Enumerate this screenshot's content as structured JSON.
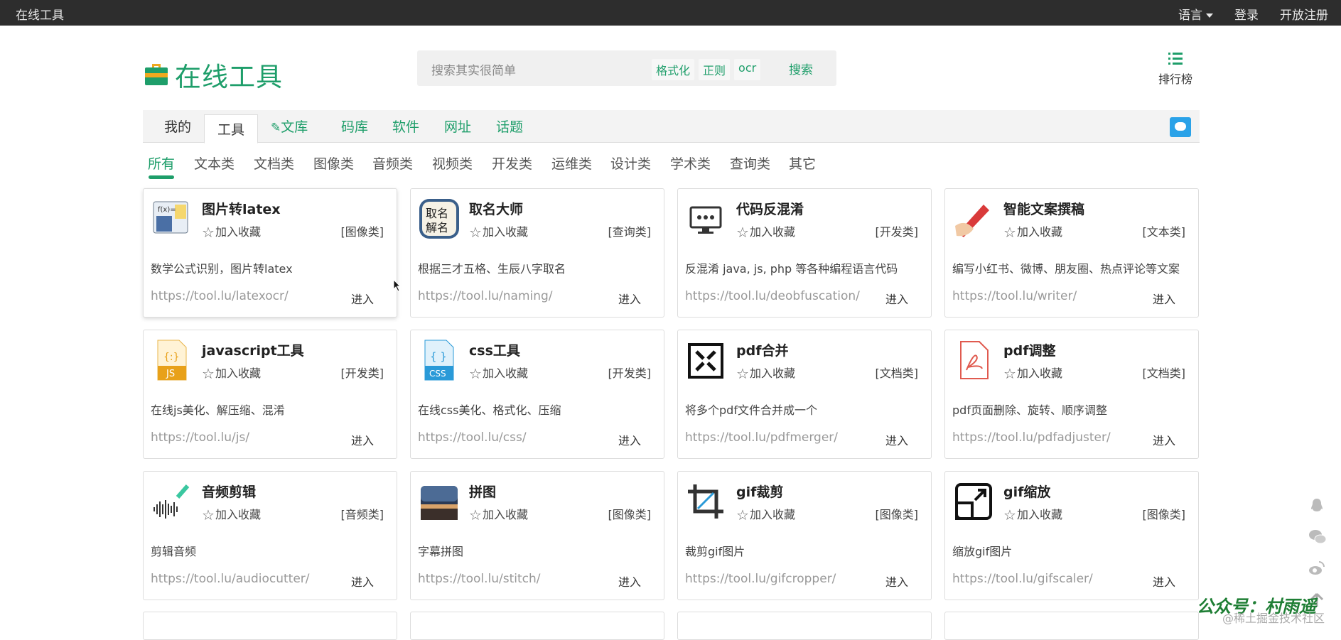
{
  "topbar": {
    "site": "在线工具",
    "language": "语言",
    "login": "登录",
    "register": "开放注册"
  },
  "logo": {
    "text": "在线工具"
  },
  "search": {
    "placeholder": "搜索其实很简单",
    "quick": [
      "格式化",
      "正则",
      "ocr"
    ],
    "button": "搜索"
  },
  "rank": {
    "label": "排行榜"
  },
  "nav": {
    "tabs": [
      "我的",
      "工具",
      "文库",
      "码库",
      "软件",
      "网址",
      "话题"
    ]
  },
  "categories": [
    "所有",
    "文本类",
    "文档类",
    "图像类",
    "音频类",
    "视频类",
    "开发类",
    "运维类",
    "设计类",
    "学术类",
    "查询类",
    "其它"
  ],
  "common": {
    "fav": "加入收藏",
    "go": "进入"
  },
  "tools": [
    {
      "title": "图片转latex",
      "cat": "[图像类]",
      "desc": "数学公式识别，图片转latex",
      "url": "https://tool.lu/latexocr/",
      "icon": "formula-icon"
    },
    {
      "title": "取名大师",
      "cat": "[查询类]",
      "desc": "根据三才五格、生辰八字取名",
      "url": "https://tool.lu/naming/",
      "icon": "naming-icon",
      "icon_text": "取名解名"
    },
    {
      "title": "代码反混淆",
      "cat": "[开发类]",
      "desc": "反混淆 java, js, php 等各种编程语言代码",
      "url": "https://tool.lu/deobfuscation/",
      "icon": "monitor-icon"
    },
    {
      "title": "智能文案撰稿",
      "cat": "[文本类]",
      "desc": "编写小红书、微博、朋友圈、热点评论等文案",
      "url": "https://tool.lu/writer/",
      "icon": "pen-icon"
    },
    {
      "title": "javascript工具",
      "cat": "[开发类]",
      "desc": "在线js美化、解压缩、混淆",
      "url": "https://tool.lu/js/",
      "icon": "js-file-icon",
      "icon_text": "JS"
    },
    {
      "title": "css工具",
      "cat": "[开发类]",
      "desc": "在线css美化、格式化、压缩",
      "url": "https://tool.lu/css/",
      "icon": "css-file-icon",
      "icon_text": "CSS"
    },
    {
      "title": "pdf合并",
      "cat": "[文档类]",
      "desc": "将多个pdf文件合并成一个",
      "url": "https://tool.lu/pdfmerger/",
      "icon": "merge-icon"
    },
    {
      "title": "pdf调整",
      "cat": "[文档类]",
      "desc": "pdf页面删除、旋转、顺序调整",
      "url": "https://tool.lu/pdfadjuster/",
      "icon": "pdf-icon"
    },
    {
      "title": "音频剪辑",
      "cat": "[音频类]",
      "desc": "剪辑音频",
      "url": "https://tool.lu/audiocutter/",
      "icon": "audio-wave-icon"
    },
    {
      "title": "拼图",
      "cat": "[图像类]",
      "desc": "字幕拼图",
      "url": "https://tool.lu/stitch/",
      "icon": "photo-icon"
    },
    {
      "title": "gif裁剪",
      "cat": "[图像类]",
      "desc": "裁剪gif图片",
      "url": "https://tool.lu/gifcropper/",
      "icon": "crop-icon"
    },
    {
      "title": "gif缩放",
      "cat": "[图像类]",
      "desc": "缩放gif图片",
      "url": "https://tool.lu/gifscaler/",
      "icon": "scale-icon"
    }
  ],
  "watermark": {
    "line1": "公众号：村雨遥",
    "line2": "@稀土掘金技术社区"
  },
  "colors": {
    "brand": "#1e9e6a",
    "topbar": "#2d2d2d",
    "accent": "#f0a91f"
  }
}
